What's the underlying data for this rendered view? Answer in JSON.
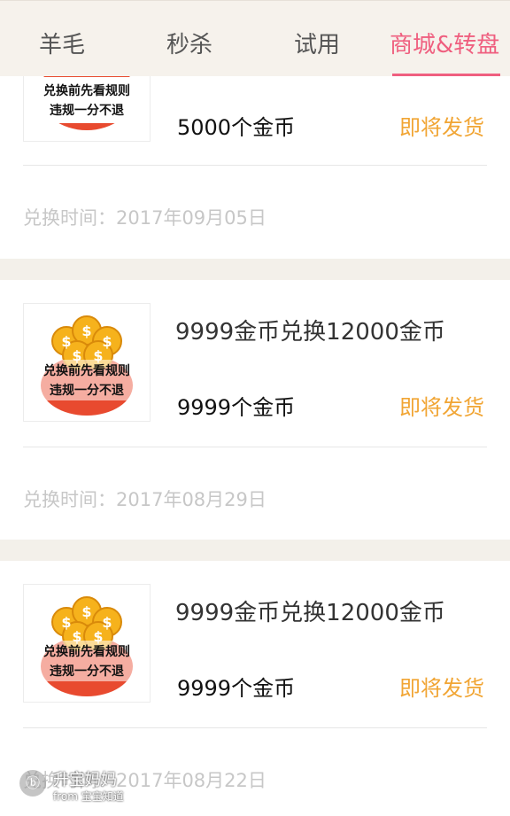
{
  "tabs": [
    {
      "label": "羊毛"
    },
    {
      "label": "秒杀"
    },
    {
      "label": "试用"
    },
    {
      "label": "商城&转盘"
    }
  ],
  "active_tab": "商城&转盘",
  "orders": [
    {
      "title": "",
      "price": "5000个金币",
      "status": "即将发货",
      "time": "兑换时间：2017年09月05日",
      "image_text_1": "兑换前先看规则",
      "image_text_2": "违规一分不退"
    },
    {
      "title": "9999金币兑换12000金币",
      "price": "9999个金币",
      "status": "即将发货",
      "time": "兑换时间：2017年08月29日",
      "image_text_1": "兑换前先看规则",
      "image_text_2": "违规一分不退"
    },
    {
      "title": "9999金币兑换12000金币",
      "price": "9999个金币",
      "status": "即将发货",
      "time": "兑换时间：2017年08月22日",
      "image_text_1": "兑换前先看规则",
      "image_text_2": "违规一分不退"
    }
  ],
  "watermark": {
    "logo": "ⓑ",
    "name": "升宝妈妈",
    "sub": "from 宝宝知道"
  },
  "colors": {
    "accent": "#ef5f7f",
    "status": "#f1a534",
    "background": "#f3f0ea"
  }
}
